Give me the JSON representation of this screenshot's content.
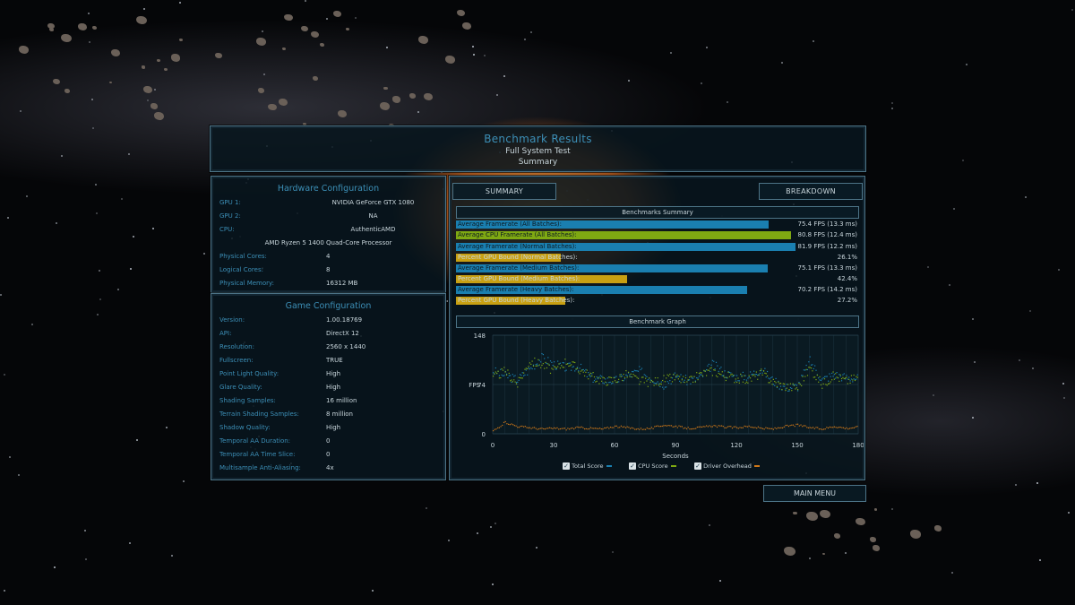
{
  "header": {
    "title": "Benchmark Results",
    "subtitle": "Full System Test",
    "view": "Summary"
  },
  "hardware": {
    "title": "Hardware Configuration",
    "rows": [
      {
        "key": "GPU 1:",
        "value": "NVIDIA GeForce GTX 1080"
      },
      {
        "key": "GPU 2:",
        "value": "NA"
      },
      {
        "key": "CPU:",
        "value": "AuthenticAMD"
      },
      {
        "key": "",
        "value": "AMD Ryzen 5 1400 Quad-Core Processor"
      },
      {
        "key": "Physical Cores:",
        "value": "4"
      },
      {
        "key": "Logical Cores:",
        "value": "8"
      },
      {
        "key": "Physical Memory:",
        "value": "16312 MB"
      }
    ]
  },
  "game_config": {
    "title": "Game Configuration",
    "rows": [
      {
        "key": "Version:",
        "value": "1.00.18769"
      },
      {
        "key": "API:",
        "value": "DirectX 12"
      },
      {
        "key": "Resolution:",
        "value": "2560 x 1440"
      },
      {
        "key": "Fullscreen:",
        "value": "TRUE"
      },
      {
        "key": "Point Light Quality:",
        "value": "High"
      },
      {
        "key": "Glare Quality:",
        "value": "High"
      },
      {
        "key": "Shading Samples:",
        "value": "16 million"
      },
      {
        "key": "Terrain Shading Samples:",
        "value": "8 million"
      },
      {
        "key": "Shadow Quality:",
        "value": "High"
      },
      {
        "key": "Temporal AA Duration:",
        "value": "0"
      },
      {
        "key": "Temporal AA Time Slice:",
        "value": "0"
      },
      {
        "key": "Multisample Anti-Aliasing:",
        "value": "4x"
      }
    ]
  },
  "tabs": {
    "summary": "SUMMARY",
    "breakdown": "BREAKDOWN"
  },
  "summary": {
    "title": "Benchmarks Summary",
    "rows": [
      {
        "label": "Average Framerate (All Batches):",
        "value": "75.4 FPS (13.3 ms)",
        "fraction": 0.776,
        "color": "#1a7fb0"
      },
      {
        "label": "Average CPU Framerate (All Batches):",
        "value": "80.8 FPS (12.4 ms)",
        "fraction": 0.831,
        "color": "#7fa912"
      },
      {
        "label": "Average Framerate (Normal Batches):",
        "value": "81.9 FPS (12.2 ms)",
        "fraction": 0.842,
        "color": "#1a7fb0"
      },
      {
        "label": "Percent GPU Bound (Normal Batches):",
        "value": "26.1%",
        "fraction": 0.261,
        "color": "#c8a012"
      },
      {
        "label": "Average Framerate (Medium Batches):",
        "value": "75.1 FPS (13.3 ms)",
        "fraction": 0.773,
        "color": "#1a7fb0"
      },
      {
        "label": "Percent GPU Bound (Medium Batches):",
        "value": "42.4%",
        "fraction": 0.424,
        "color": "#c8a012"
      },
      {
        "label": "Average Framerate (Heavy Batches):",
        "value": "70.2 FPS (14.2 ms)",
        "fraction": 0.722,
        "color": "#1a7fb0"
      },
      {
        "label": "Percent GPU Bound (Heavy Batches):",
        "value": "27.2%",
        "fraction": 0.272,
        "color": "#c8a012"
      }
    ]
  },
  "graph": {
    "title": "Benchmark Graph"
  },
  "chart_data": {
    "type": "scatter",
    "xlabel": "Seconds",
    "ylabel": "FPS",
    "xlim": [
      0,
      180
    ],
    "ylim": [
      0,
      148
    ],
    "xticks": [
      0,
      30,
      60,
      90,
      120,
      150,
      180
    ],
    "yticks": [
      0,
      74,
      148
    ],
    "grid": true,
    "legend": "bottom",
    "series": [
      {
        "name": "Total Score",
        "color": "#1a7fb0",
        "x": [
          0,
          6,
          12,
          18,
          24,
          30,
          36,
          42,
          48,
          54,
          60,
          66,
          72,
          78,
          84,
          90,
          96,
          102,
          108,
          114,
          120,
          126,
          132,
          138,
          144,
          150,
          156,
          162,
          168,
          174,
          180
        ],
        "values": [
          95,
          88,
          82,
          98,
          115,
          105,
          100,
          102,
          85,
          82,
          80,
          88,
          95,
          85,
          75,
          88,
          80,
          85,
          105,
          92,
          86,
          88,
          98,
          80,
          70,
          72,
          110,
          82,
          90,
          85,
          84
        ]
      },
      {
        "name": "CPU Score",
        "color": "#7fa912",
        "x": [
          0,
          6,
          12,
          18,
          24,
          30,
          36,
          42,
          48,
          54,
          60,
          66,
          72,
          78,
          84,
          90,
          96,
          102,
          108,
          114,
          120,
          126,
          132,
          138,
          144,
          150,
          156,
          162,
          168,
          174,
          180
        ],
        "values": [
          85,
          95,
          75,
          110,
          105,
          95,
          110,
          98,
          88,
          80,
          82,
          90,
          80,
          78,
          82,
          85,
          78,
          90,
          95,
          88,
          84,
          82,
          92,
          78,
          72,
          70,
          100,
          75,
          88,
          80,
          86
        ]
      },
      {
        "name": "Driver Overhead",
        "color": "#d07818",
        "x": [
          0,
          6,
          12,
          18,
          24,
          30,
          36,
          42,
          48,
          54,
          60,
          66,
          72,
          78,
          84,
          90,
          96,
          102,
          108,
          114,
          120,
          126,
          132,
          138,
          144,
          150,
          156,
          162,
          168,
          174,
          180
        ],
        "values": [
          5,
          18,
          12,
          10,
          8,
          9,
          8,
          10,
          9,
          8,
          12,
          10,
          8,
          9,
          14,
          12,
          9,
          10,
          13,
          11,
          10,
          12,
          9,
          8,
          12,
          14,
          10,
          8,
          12,
          9,
          11
        ]
      }
    ]
  },
  "legend": {
    "total": "Total Score",
    "cpu": "CPU Score",
    "driver": "Driver Overhead"
  },
  "footer": {
    "main_menu": "MAIN MENU"
  },
  "colors": {
    "accent": "#3c8fb7",
    "border": "#4d7487"
  }
}
